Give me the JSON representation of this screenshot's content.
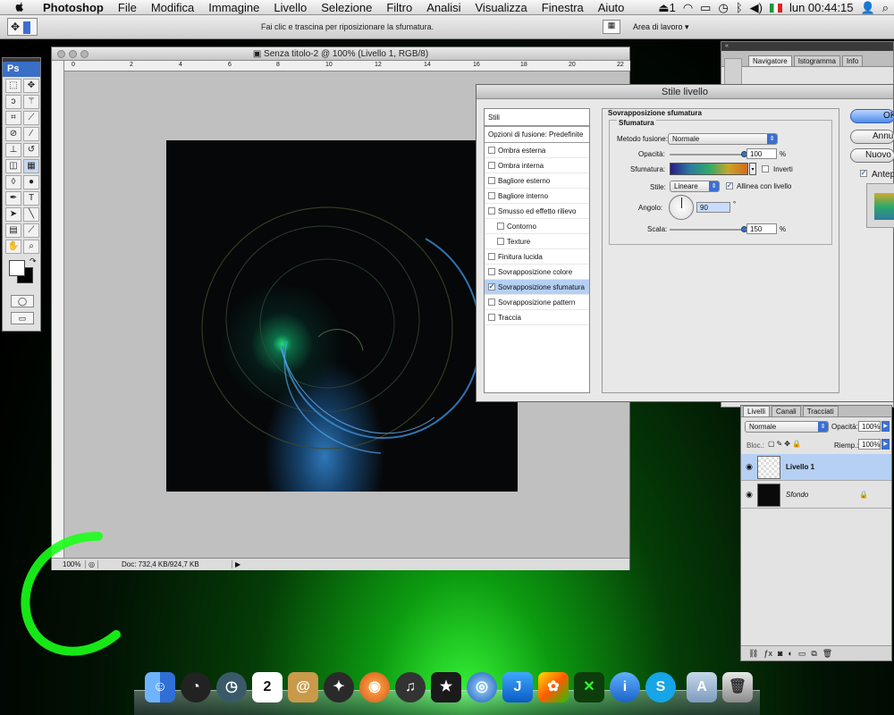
{
  "menubar": {
    "items": [
      "Photoshop",
      "File",
      "Modifica",
      "Immagine",
      "Livello",
      "Selezione",
      "Filtro",
      "Analisi",
      "Visualizza",
      "Finestra",
      "Aiuto"
    ],
    "clock": "lun 00:44:15",
    "battery_count": "1"
  },
  "optionsbar": {
    "hint": "Fai clic e trascina per riposizionare la sfumatura.",
    "workspace": "Area di lavoro"
  },
  "document": {
    "title": "Senza titolo-2 @ 100% (Livello 1, RGB/8)",
    "zoom": "100%",
    "doc_info": "Doc: 732,4 KB/924,7 KB",
    "ruler_marks": [
      "0",
      "2",
      "4",
      "6",
      "8",
      "10",
      "12",
      "14",
      "16",
      "18",
      "20",
      "22"
    ]
  },
  "tools": {
    "logo": "Ps"
  },
  "navigator": {
    "tabs": [
      "Navigatore",
      "Istogramma",
      "Info"
    ]
  },
  "dialog": {
    "title": "Stile livello",
    "list_header": "Stili",
    "blend_options": "Opzioni di fusione: Predefinite",
    "styles": [
      {
        "label": "Ombra esterna",
        "checked": false,
        "indent": false
      },
      {
        "label": "Ombra interna",
        "checked": false,
        "indent": false
      },
      {
        "label": "Bagliore esterno",
        "checked": false,
        "indent": false
      },
      {
        "label": "Bagliore interno",
        "checked": false,
        "indent": false
      },
      {
        "label": "Smusso ed effetto rilievo",
        "checked": false,
        "indent": false
      },
      {
        "label": "Contorno",
        "checked": false,
        "indent": true
      },
      {
        "label": "Texture",
        "checked": false,
        "indent": true
      },
      {
        "label": "Finitura lucida",
        "checked": false,
        "indent": false
      },
      {
        "label": "Sovrapposizione colore",
        "checked": false,
        "indent": false
      },
      {
        "label": "Sovrapposizione sfumatura",
        "checked": true,
        "indent": false
      },
      {
        "label": "Sovrapposizione pattern",
        "checked": false,
        "indent": false
      },
      {
        "label": "Traccia",
        "checked": false,
        "indent": false
      }
    ],
    "section_title": "Sovrapposizione sfumatura",
    "group_title": "Sfumatura",
    "blend_mode_label": "Metodo fusione:",
    "blend_mode_value": "Normale",
    "opacity_label": "Opacità:",
    "opacity_value": "100",
    "opacity_fraction": 1.0,
    "gradient_label": "Sfumatura:",
    "invert_label": "Inverti",
    "style_label": "Stile:",
    "style_value": "Lineare",
    "align_label": "Allinea con livello",
    "angle_label": "Angolo:",
    "angle_value": "90",
    "angle_unit": "°",
    "scale_label": "Scala:",
    "scale_value": "150",
    "scale_fraction": 1.0,
    "percent": "%",
    "buttons": {
      "ok": "OK",
      "cancel": "Annulla",
      "new_style": "Nuovo stile...",
      "preview": "Anteprima"
    }
  },
  "layers": {
    "tabs": [
      "Livelli",
      "Canali",
      "Tracciati"
    ],
    "blend_mode": "Normale",
    "opacity_label": "Opacità:",
    "opacity_value": "100%",
    "lock_label": "Bloc.:",
    "fill_label": "Riemp.:",
    "fill_value": "100%",
    "items": [
      {
        "name": "Livello 1",
        "selected": true
      },
      {
        "name": "Sfondo",
        "selected": false
      }
    ]
  },
  "colors": {
    "accent": "#3c6fd1",
    "selection": "#b5d0f3",
    "desktop_green": "#1aff1a"
  }
}
